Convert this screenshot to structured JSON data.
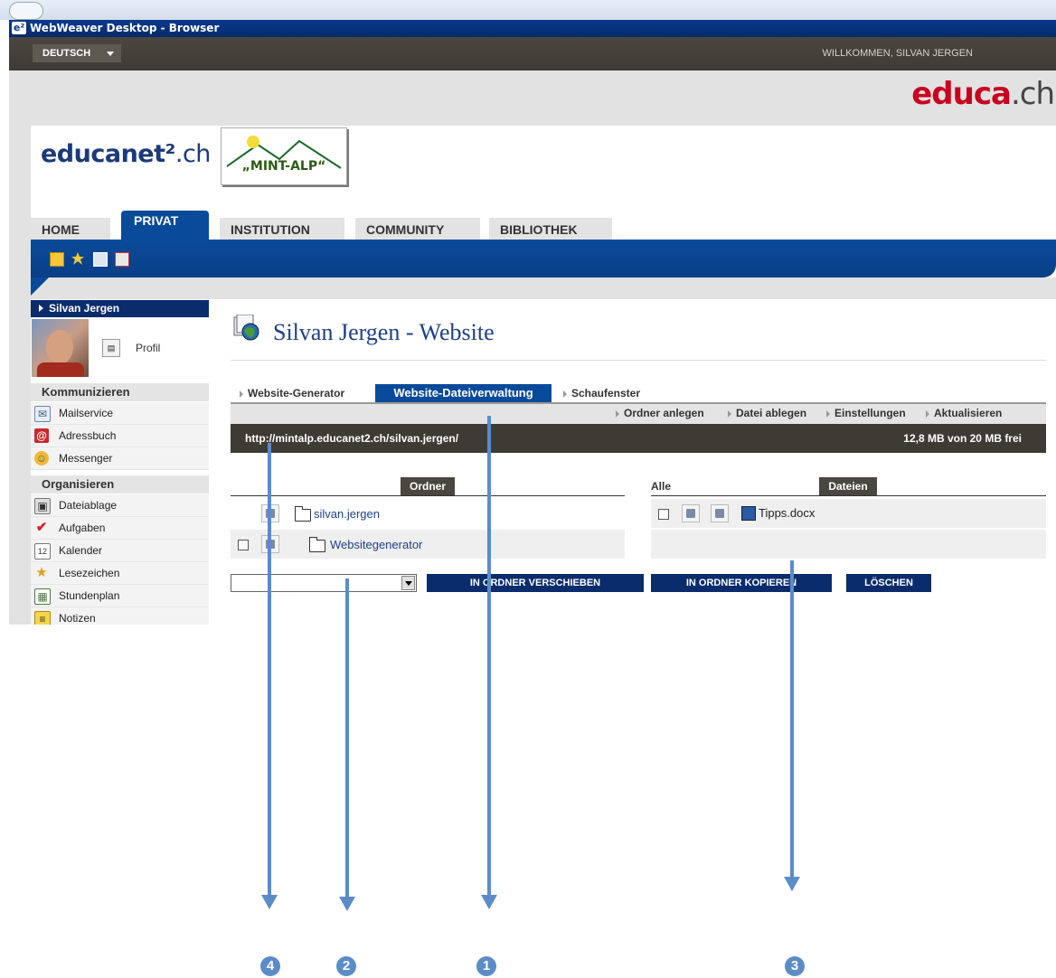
{
  "window": {
    "title": "WebWeaver Desktop - Browser",
    "icon_text": "e²"
  },
  "topbar": {
    "language": "DEUTSCH",
    "welcome": "WILLKOMMEN, SILVAN JERGEN"
  },
  "branding": {
    "educa_red": "educa",
    "educa_grey": ".ch",
    "logo_bold": "educanet²",
    "logo_rest": ".ch",
    "mint_logo": "„MINT-ALP“"
  },
  "tabs": [
    {
      "label": "HOME"
    },
    {
      "label": "PRIVAT"
    },
    {
      "label": "INSTITUTION"
    },
    {
      "label": "COMMUNITY"
    },
    {
      "label": "BIBLIOTHEK"
    }
  ],
  "toolbar_icons": [
    "notes-icon",
    "favorite-add-icon",
    "computer-icon",
    "help-icon"
  ],
  "sidebar": {
    "user": "Silvan Jergen",
    "profile_label": "Profil",
    "sections": [
      {
        "title": "Kommunizieren",
        "items": [
          "Mailservice",
          "Adressbuch",
          "Messenger"
        ]
      },
      {
        "title": "Organisieren",
        "items": [
          "Dateiablage",
          "Aufgaben",
          "Kalender",
          "Lesezeichen",
          "Stundenplan",
          "Notizen"
        ]
      }
    ]
  },
  "main": {
    "title": "Silvan Jergen - Website",
    "subtabs": [
      "Website-Generator",
      "Website-Dateiverwaltung",
      "Schaufenster"
    ],
    "actions": [
      "Ordner anlegen",
      "Datei ablegen",
      "Einstellungen",
      "Aktualisieren"
    ],
    "url": "http://mintalp.educanet2.ch/silvan.jergen/",
    "quota": "12,8 MB von 20 MB frei",
    "folders_header": "Ordner",
    "files_header": "Dateien",
    "all_label": "Alle",
    "folders": [
      "silvan.jergen",
      "Websitegenerator"
    ],
    "files": [
      "Tipps.docx"
    ],
    "buttons": {
      "move": "IN ORDNER VERSCHIEBEN",
      "copy": "IN ORDNER KOPIEREN",
      "delete": "LÖSCHEN"
    }
  },
  "annotations": {
    "colors": {
      "arrow": "#5b8cc8"
    },
    "markers": [
      "4",
      "2",
      "1",
      "3"
    ]
  },
  "colors": {
    "brand_blue": "#0a4a9a",
    "navy": "#0b2c6c",
    "dark_bar": "#3e3b35",
    "educa_red": "#c8001e"
  }
}
